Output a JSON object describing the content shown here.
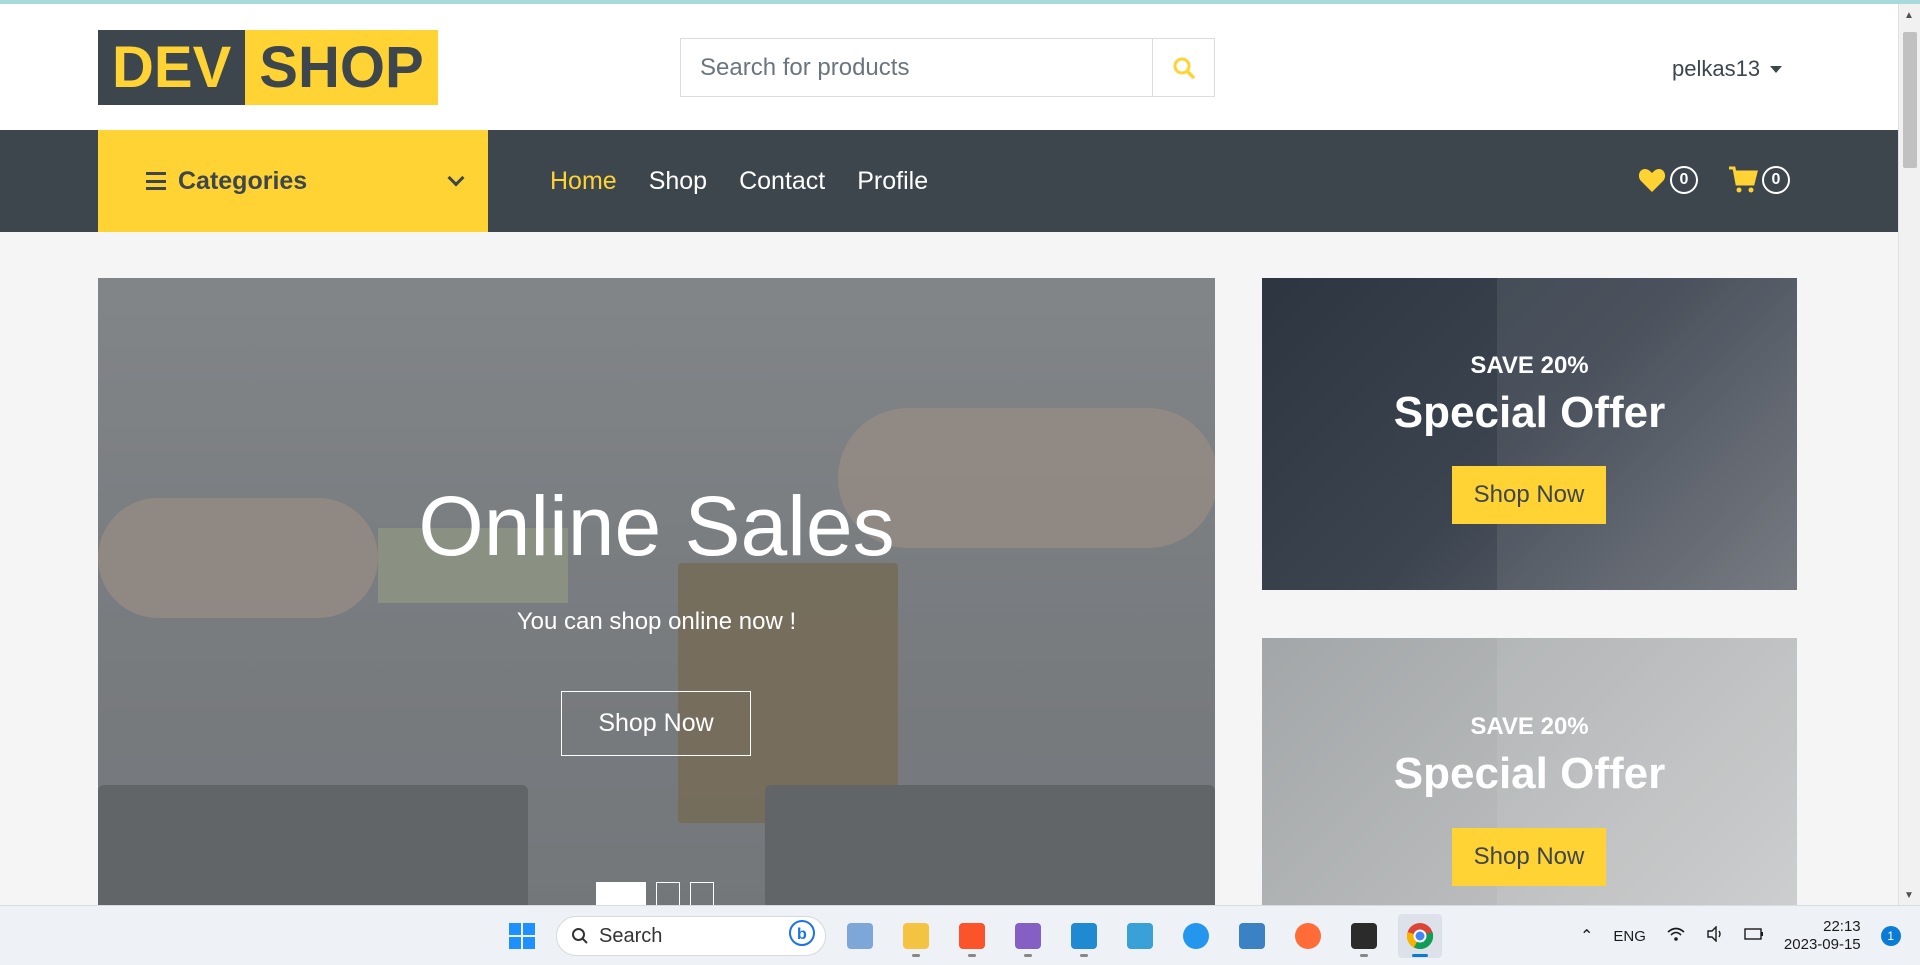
{
  "brand": {
    "part1": "DEV",
    "part2": "SHOP"
  },
  "search": {
    "placeholder": "Search for products",
    "icon": "search-icon"
  },
  "user": {
    "name": "pelkas13"
  },
  "nav": {
    "categories_label": "Categories",
    "links": [
      "Home",
      "Shop",
      "Contact",
      "Profile"
    ],
    "active_link": "Home",
    "wishlist_count": "0",
    "cart_count": "0"
  },
  "hero": {
    "title": "Online Sales",
    "subtitle": "You can shop online now !",
    "cta": "Shop Now",
    "slides": 3,
    "active_slide": 1
  },
  "offers": [
    {
      "pretitle": "SAVE 20%",
      "title": "Special Offer",
      "cta": "Shop Now"
    },
    {
      "pretitle": "SAVE 20%",
      "title": "Special Offer",
      "cta": "Shop Now"
    }
  ],
  "taskbar": {
    "search_label": "Search",
    "apps": [
      "start-icon",
      "bing-icon",
      "photos-icon",
      "file-explorer-icon",
      "brave-icon",
      "visual-studio-icon",
      "vscode-icon",
      "azure-icon",
      "docker-icon",
      "notepad-icon",
      "postman-icon",
      "terminal-icon",
      "chrome-icon"
    ],
    "language": "ENG",
    "time": "22:13",
    "date": "2023-09-15",
    "notifications": "1"
  },
  "colors": {
    "accent": "#ffd333",
    "dark": "#3d464d"
  }
}
